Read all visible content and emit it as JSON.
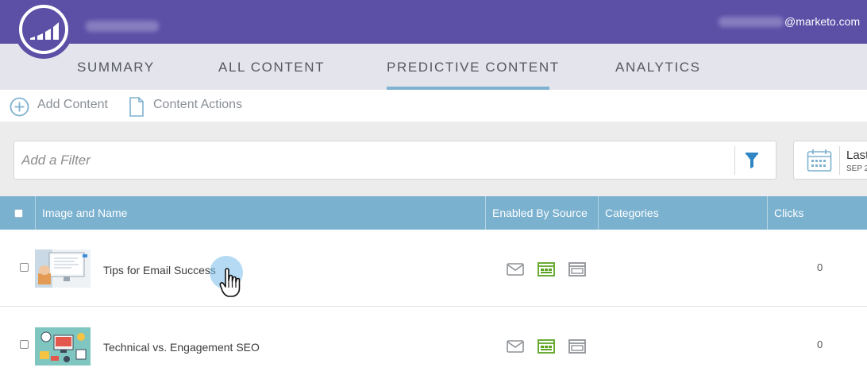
{
  "header": {
    "user_email_suffix": "@marketo.com",
    "brand_color": "#5b4fa6"
  },
  "tabs": [
    {
      "label": "SUMMARY",
      "active": false
    },
    {
      "label": "ALL CONTENT",
      "active": false
    },
    {
      "label": "PREDICTIVE CONTENT",
      "active": true
    },
    {
      "label": "ANALYTICS",
      "active": false
    }
  ],
  "toolbar": {
    "add_content": {
      "label": "Add Content",
      "icon": "plus-circle-icon"
    },
    "content_actions": {
      "label": "Content Actions",
      "icon": "document-icon"
    }
  },
  "filter": {
    "placeholder": "Add a Filter",
    "icon": "funnel-icon"
  },
  "date_range": {
    "label": "Last",
    "sub": "SEP 2",
    "icon": "calendar-icon"
  },
  "table": {
    "columns": [
      "Image and Name",
      "Enabled By Source",
      "Categories",
      "Clicks"
    ],
    "header_color": "#7ab1cf",
    "rows": [
      {
        "name": "Tips for Email Success",
        "sources": [
          "email-icon",
          "web-page-icon",
          "rich-media-icon"
        ],
        "categories": "",
        "clicks": "0"
      },
      {
        "name": "Technical vs. Engagement SEO",
        "sources": [
          "email-icon",
          "web-page-icon",
          "rich-media-icon"
        ],
        "categories": "",
        "clicks": "0"
      }
    ]
  }
}
